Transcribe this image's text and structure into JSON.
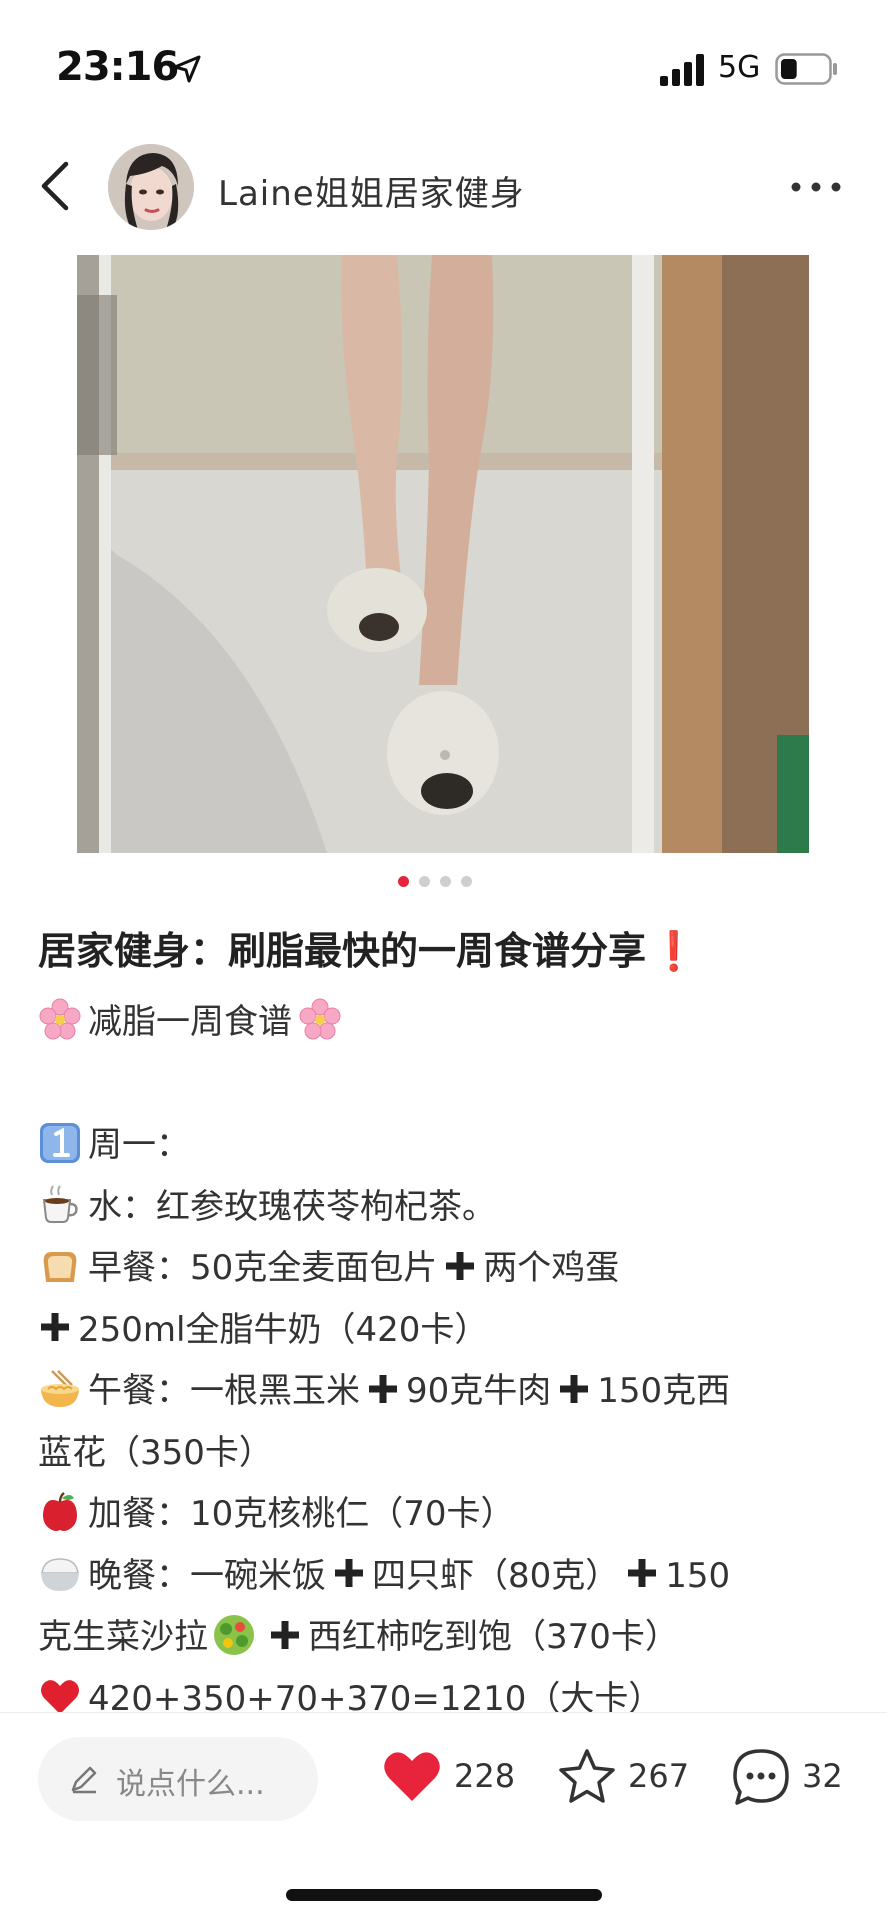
{
  "status_bar": {
    "time": "23:16",
    "network": "5G",
    "battery_level": 0.35
  },
  "header": {
    "author_name": "Laine姐姐居家健身"
  },
  "carousel": {
    "total": 4,
    "active_index": 0,
    "active_color": "#e8243c"
  },
  "post": {
    "title": "居家健身：刷脂最快的一周食谱分享",
    "title_mark": "❗",
    "subtitle": "减脂一周食谱",
    "day_label": "周一：",
    "lines": {
      "water": "水：红参玫瑰茯苓枸杞茶。",
      "breakfast_a": "早餐：50克全麦面包片",
      "breakfast_b": "两个鸡蛋",
      "breakfast_c": "250ml全脂牛奶（420卡）",
      "lunch_a": "午餐：一根黑玉米",
      "lunch_b": "90克牛肉",
      "lunch_c": "150克西",
      "lunch_d": "蓝花（350卡）",
      "snack": "加餐：10克核桃仁（70卡）",
      "dinner_a": "晚餐：一碗米饭",
      "dinner_b": "四只虾（80克）",
      "dinner_c": "150",
      "dinner_d": "克生菜沙拉",
      "dinner_e": "西红柿吃到饱（370卡）",
      "total": "420+350+70+370=1210（大卡）"
    }
  },
  "bottom_bar": {
    "comment_placeholder": "说点什么...",
    "likes": "228",
    "favorites": "267",
    "comments": "32",
    "like_color": "#e8243c"
  }
}
